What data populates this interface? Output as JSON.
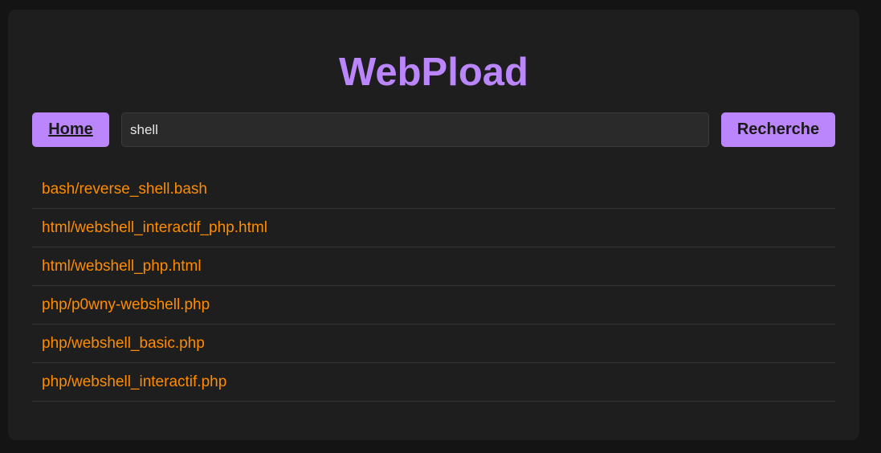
{
  "app": {
    "title": "WebPload"
  },
  "nav": {
    "home_label": "Home",
    "search_label": "Recherche"
  },
  "search": {
    "value": "shell",
    "placeholder": ""
  },
  "results": [
    {
      "path": "bash/reverse_shell.bash"
    },
    {
      "path": "html/webshell_interactif_php.html"
    },
    {
      "path": "html/webshell_php.html"
    },
    {
      "path": "php/p0wny-webshell.php"
    },
    {
      "path": "php/webshell_basic.php"
    },
    {
      "path": "php/webshell_interactif.php"
    }
  ],
  "colors": {
    "accent": "#bb86fc",
    "link": "#ff8c00",
    "card_background": "#1e1e1e",
    "page_background": "#141414"
  }
}
